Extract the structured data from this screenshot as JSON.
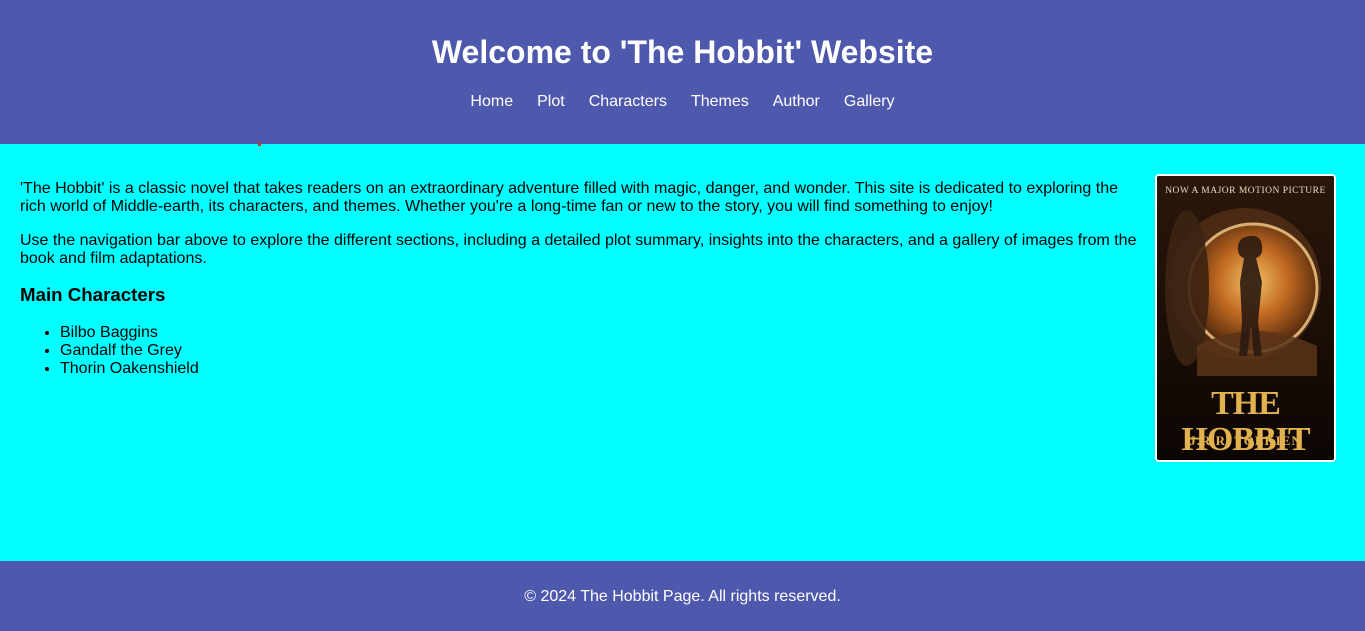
{
  "header": {
    "title": "Welcome to 'The Hobbit' Website",
    "nav": [
      "Home",
      "Plot",
      "Characters",
      "Themes",
      "Author",
      "Gallery"
    ]
  },
  "main": {
    "intro_1": "'The Hobbit' is a classic novel that takes readers on an extraordinary adventure filled with magic, danger, and wonder. This site is dedicated to exploring the rich world of Middle-earth, its characters, and themes. Whether you're a long-time fan or new to the story, you will find something to enjoy!",
    "intro_2": "Use the navigation bar above to explore the different sections, including a detailed plot summary, insights into the characters, and a gallery of images from the book and film adaptations.",
    "characters_heading": "Main Characters",
    "characters": [
      "Bilbo Baggins",
      "Gandalf the Grey",
      "Thorin Oakenshield"
    ]
  },
  "cover": {
    "tagline": "NOW A MAJOR MOTION PICTURE",
    "title": "THE HOBBIT",
    "author": "J.R.R. TOLKIEN"
  },
  "footer": {
    "text": "© 2024 The Hobbit Page. All rights reserved."
  },
  "colors": {
    "header_bg": "#4e58ad",
    "page_bg": "#00ffff",
    "text_light": "#ffffff"
  }
}
